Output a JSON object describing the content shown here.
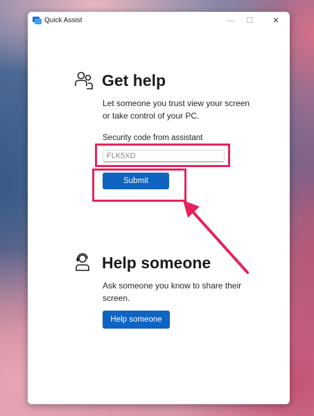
{
  "window": {
    "title": "Quick Assist"
  },
  "titlebar": {
    "minimize_glyph": "—",
    "maximize_glyph": "☐",
    "close_glyph": "✕"
  },
  "get_help": {
    "icon": "people-icon",
    "heading": "Get help",
    "description_line1": "Let someone you trust view your screen",
    "description_line2": "or take control of your PC.",
    "code_label": "Security code from assistant",
    "code_value": "FLK5XD",
    "submit_label": "Submit"
  },
  "help_someone": {
    "icon": "person-support-icon",
    "heading": "Help someone",
    "description_line1": "Ask someone you know to share their",
    "description_line2": "screen.",
    "button_label": "Help someone"
  },
  "annotation": {
    "highlight_color": "#e8215c"
  },
  "colors": {
    "accent": "#0f63c1"
  }
}
